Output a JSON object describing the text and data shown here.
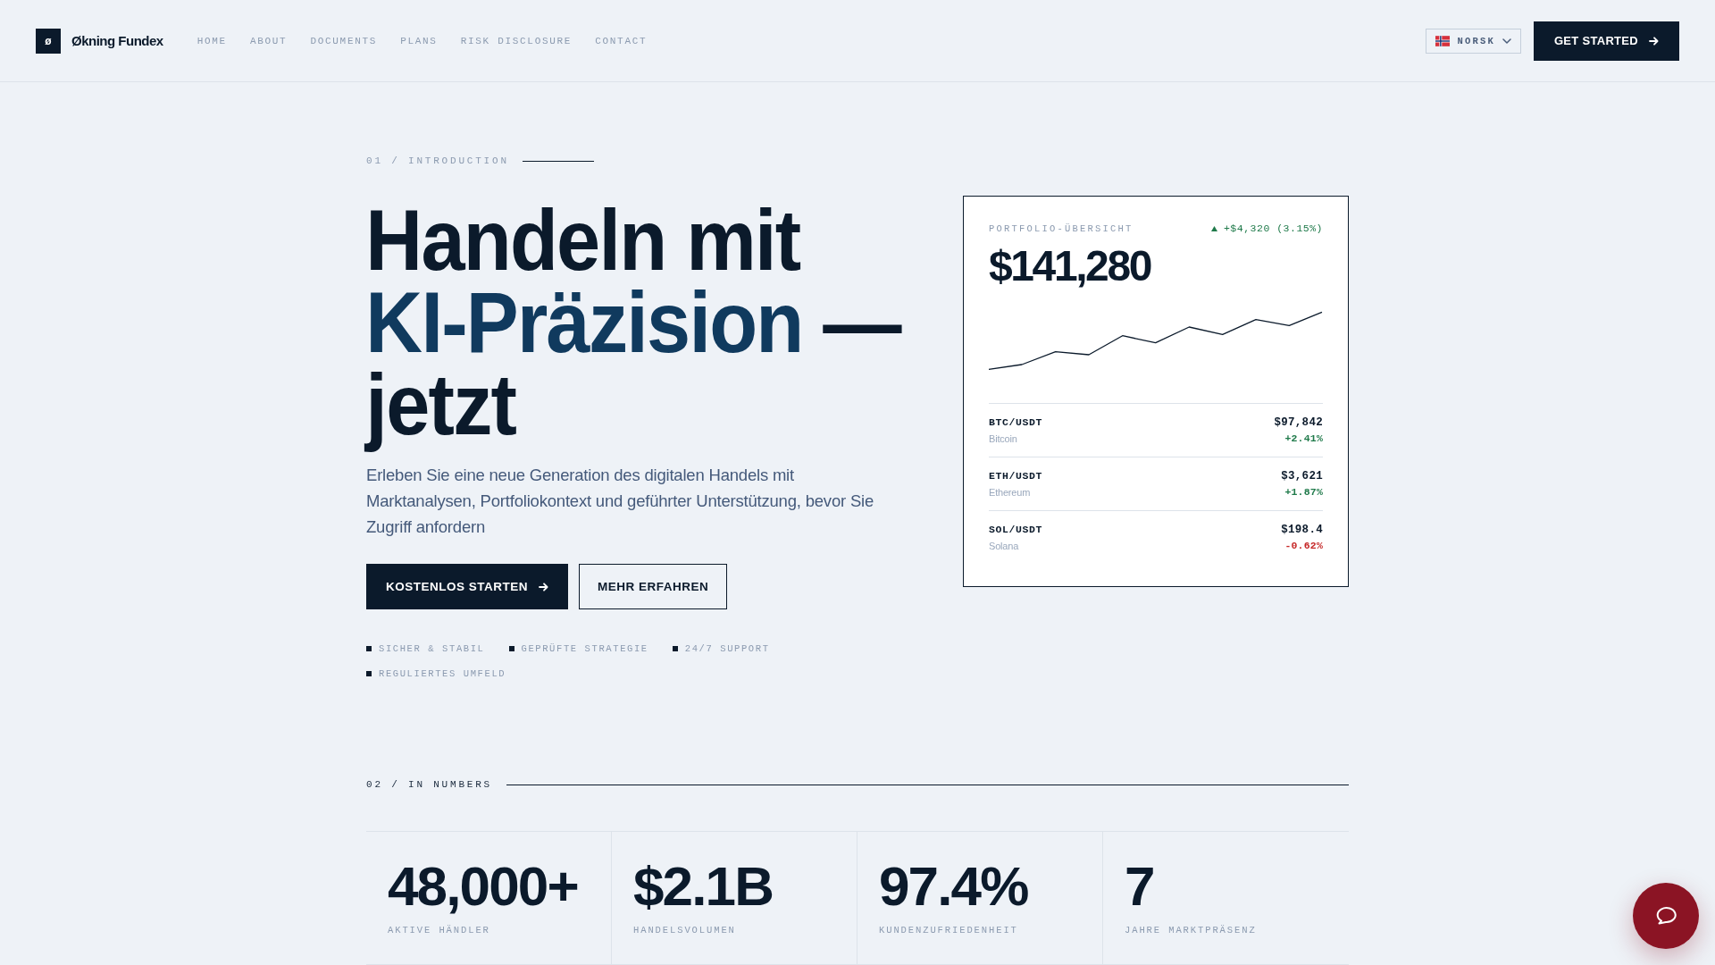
{
  "header": {
    "logo_mark": "ø",
    "brand": "Økning Fundex",
    "nav": [
      "HOME",
      "ABOUT",
      "DOCUMENTS",
      "PLANS",
      "RISK DISCLOSURE",
      "CONTACT"
    ],
    "language": "NORSK",
    "cta": "GET STARTED"
  },
  "hero": {
    "section_label": "01 / INTRODUCTION",
    "headline": [
      {
        "text": "Handeln mit",
        "accent": false
      },
      {
        "text": "KI-Präzision",
        "accent": true
      },
      {
        "text": "— jetzt",
        "accent": false
      }
    ],
    "lead": "Erleben Sie eine neue Generation des digitalen Handels mit Marktanalysen, Portfoliokontext und geführter Unterstützung, bevor Sie Zugriff anfordern",
    "buttons": [
      {
        "label": "KOSTENLOS STARTEN",
        "kind": "primary"
      },
      {
        "label": "MEHR ERFAHREN",
        "kind": "secondary"
      }
    ],
    "features": [
      "SICHER & STABIL",
      "GEPRÜFTE STRATEGIE",
      "24/7 SUPPORT",
      "REGULIERTES UMFELD"
    ]
  },
  "portfolio_card": {
    "title": "PORTFOLIO-ÜBERSICHT",
    "change": {
      "text": "+$4,320 (3.15%)",
      "positive": true
    },
    "value": "$141,280",
    "assets": [
      {
        "pair": "BTC/USDT",
        "name": "Bitcoin",
        "price": "$97,842",
        "change": "+2.41%",
        "positive": true
      },
      {
        "pair": "ETH/USDT",
        "name": "Ethereum",
        "price": "$3,621",
        "change": "+1.87%",
        "positive": true
      },
      {
        "pair": "SOL/USDT",
        "name": "Solana",
        "price": "$198.4",
        "change": "-0.62%",
        "positive": false
      }
    ]
  },
  "numbers": {
    "section_label": "02 / IN NUMBERS",
    "stats": [
      {
        "value": "48,000+",
        "label": "AKTIVE HÄNDLER"
      },
      {
        "value": "$2.1B",
        "label": "HANDELSVOLUMEN"
      },
      {
        "value": "97.4%",
        "label": "KUNDENZUFRIEDENHEIT"
      },
      {
        "value": "7",
        "label": "JAHRE MARKTPRÄSENZ"
      }
    ]
  }
}
